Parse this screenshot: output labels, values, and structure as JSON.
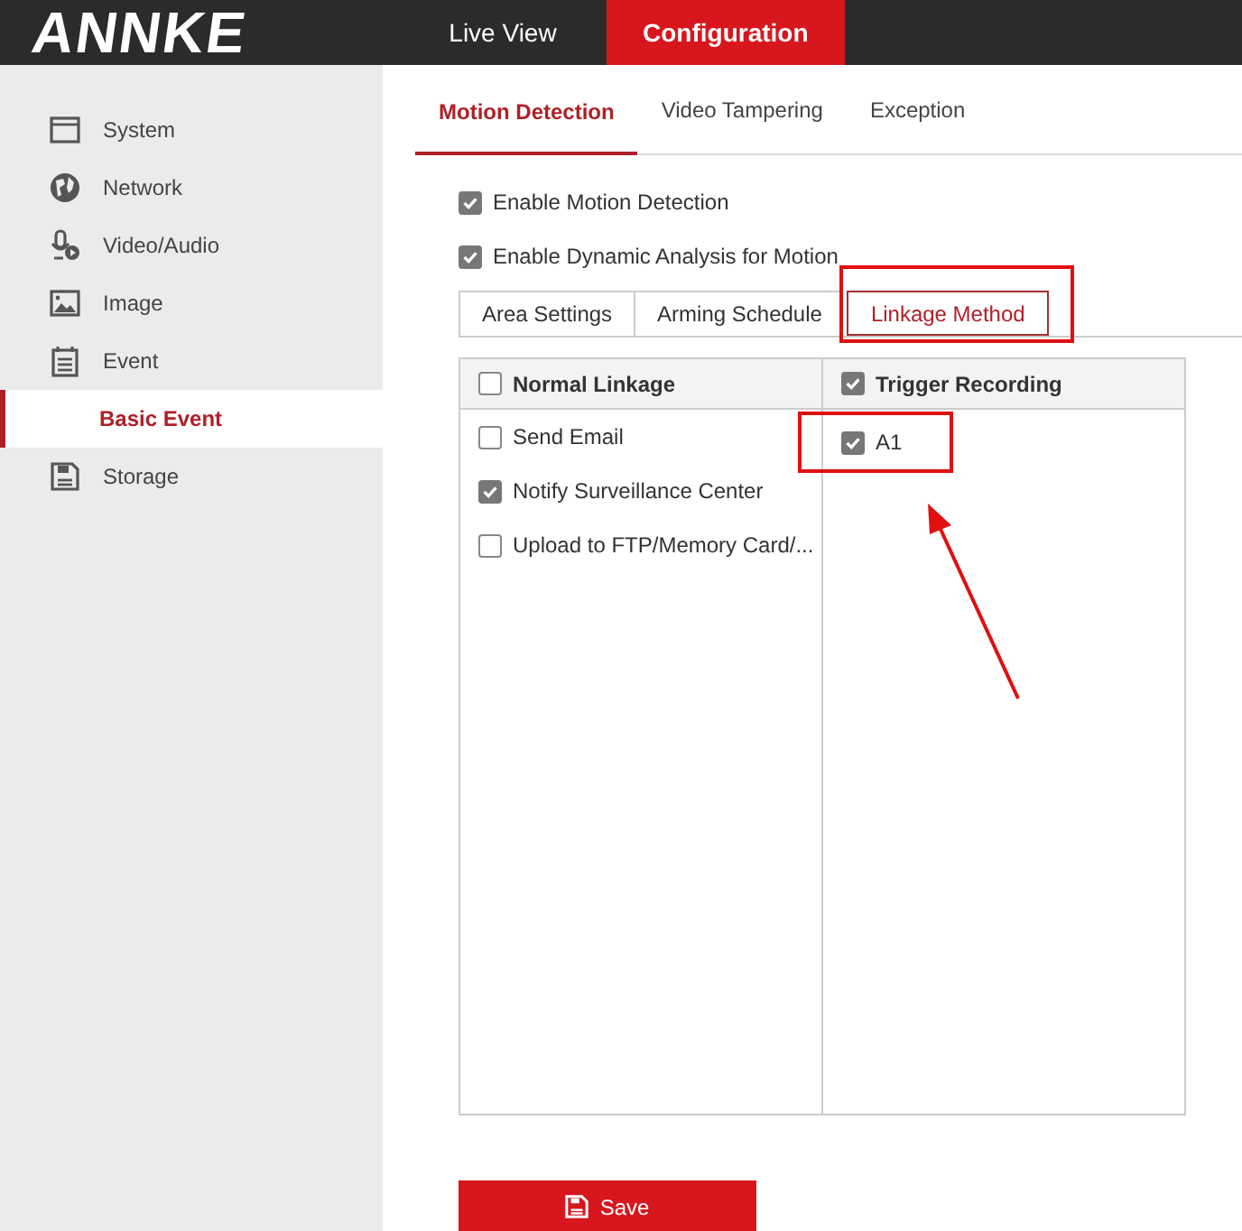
{
  "header": {
    "logo": "ANNKE",
    "nav": [
      {
        "label": "Live View",
        "selected": false
      },
      {
        "label": "Configuration",
        "selected": true
      }
    ]
  },
  "sidebar": {
    "items": [
      {
        "label": "System",
        "kind": "item",
        "selected": false
      },
      {
        "label": "Network",
        "kind": "item",
        "selected": false
      },
      {
        "label": "Video/Audio",
        "kind": "item",
        "selected": false
      },
      {
        "label": "Image",
        "kind": "item",
        "selected": false
      },
      {
        "label": "Event",
        "kind": "item",
        "selected": false
      },
      {
        "label": "Basic Event",
        "kind": "subitem",
        "selected": true
      },
      {
        "label": "Storage",
        "kind": "item",
        "selected": false
      }
    ]
  },
  "tabs": [
    {
      "label": "Motion Detection",
      "selected": true
    },
    {
      "label": "Video Tampering",
      "selected": false
    },
    {
      "label": "Exception",
      "selected": false
    }
  ],
  "options": [
    {
      "label": "Enable Motion Detection",
      "checked": true
    },
    {
      "label": "Enable Dynamic Analysis for Motion",
      "checked": true
    }
  ],
  "subtabs": [
    {
      "label": "Area Settings",
      "selected": false,
      "highlighted": false
    },
    {
      "label": "Arming Schedule",
      "selected": false,
      "highlighted": false
    },
    {
      "label": "Linkage Method",
      "selected": true,
      "highlighted": true
    }
  ],
  "linkage": [
    {
      "heading": "Normal Linkage",
      "checked": false,
      "items": [
        {
          "label": "Send Email",
          "checked": false,
          "highlighted": false
        },
        {
          "label": "Notify Surveillance Center",
          "checked": true,
          "highlighted": false
        },
        {
          "label": "Upload to FTP/Memory Card/...",
          "checked": false,
          "highlighted": false
        }
      ]
    },
    {
      "heading": "Trigger Recording",
      "checked": true,
      "items": [
        {
          "label": "A1",
          "checked": true,
          "highlighted": true
        }
      ]
    }
  ],
  "annotation_arrow": true,
  "save_button": "Save"
}
